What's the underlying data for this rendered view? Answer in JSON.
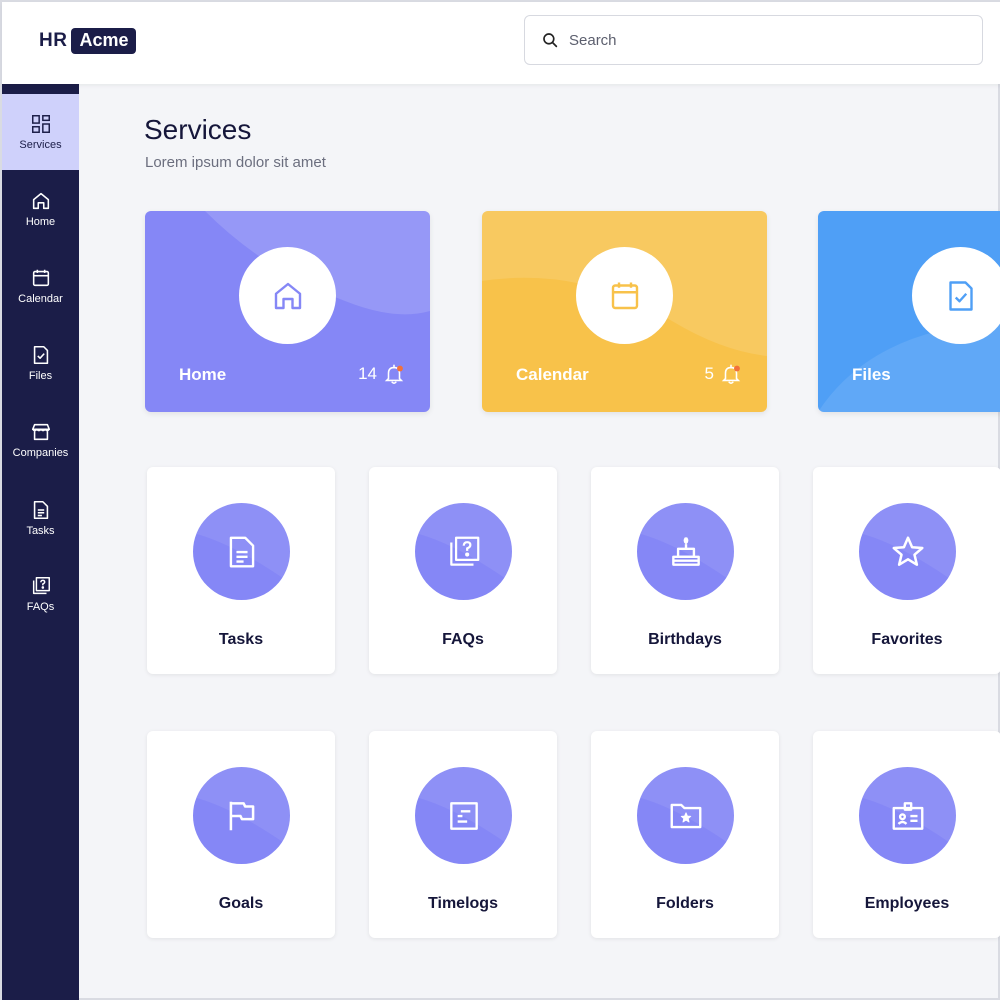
{
  "header": {
    "logo_hr": "HR",
    "logo_acme": "Acme",
    "search_placeholder": "Search",
    "search_icon": "search-icon"
  },
  "sidebar": {
    "items": [
      {
        "label": "Services",
        "icon": "grid-icon",
        "active": true
      },
      {
        "label": "Home",
        "icon": "home-icon"
      },
      {
        "label": "Calendar",
        "icon": "calendar-icon"
      },
      {
        "label": "Files",
        "icon": "file-check-icon"
      },
      {
        "label": "Companies",
        "icon": "store-icon"
      },
      {
        "label": "Tasks",
        "icon": "document-icon"
      },
      {
        "label": "FAQs",
        "icon": "faq-icon"
      }
    ]
  },
  "main": {
    "title": "Services",
    "subtitle": "Lorem ipsum dolor sit amet",
    "features": [
      {
        "label": "Home",
        "count": "14",
        "icon": "home-icon",
        "color": "#8587f6"
      },
      {
        "label": "Calendar",
        "count": "5",
        "icon": "calendar-icon",
        "color": "#f8c24a"
      },
      {
        "label": "Files",
        "count": "",
        "icon": "file-check-icon",
        "color": "#4f9ff6"
      }
    ],
    "tiles": [
      {
        "label": "Tasks",
        "icon": "document-icon"
      },
      {
        "label": "FAQs",
        "icon": "faq-icon"
      },
      {
        "label": "Birthdays",
        "icon": "cake-icon"
      },
      {
        "label": "Favorites",
        "icon": "star-icon"
      },
      {
        "label": "Goals",
        "icon": "flag-icon"
      },
      {
        "label": "Timelogs",
        "icon": "timelog-icon"
      },
      {
        "label": "Folders",
        "icon": "folder-star-icon"
      },
      {
        "label": "Employees",
        "icon": "id-badge-icon"
      }
    ]
  },
  "colors": {
    "sidebar": "#1b1d48",
    "sidebar_active": "#cfd1fb",
    "accent": "#8587f6",
    "notification_dot": "#f2713b"
  }
}
